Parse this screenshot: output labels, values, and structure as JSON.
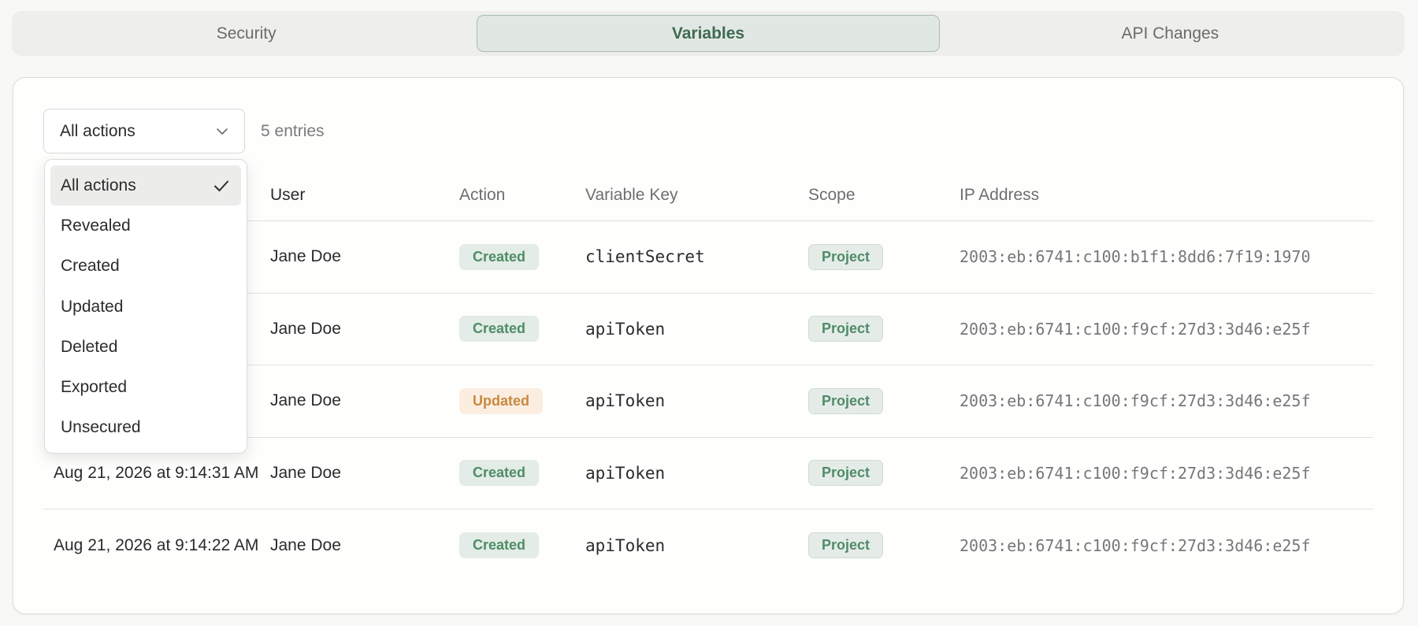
{
  "tabs": [
    {
      "label": "Security",
      "active": false
    },
    {
      "label": "Variables",
      "active": true
    },
    {
      "label": "API Changes",
      "active": false
    }
  ],
  "filter": {
    "selected": "All actions",
    "icon": "chevron-down-icon",
    "options": [
      "All actions",
      "Revealed",
      "Created",
      "Updated",
      "Deleted",
      "Exported",
      "Unsecured"
    ],
    "checked_icon": "check-icon"
  },
  "entries_count": "5 entries",
  "table": {
    "headers": {
      "user": "User",
      "action": "Action",
      "key": "Variable Key",
      "scope": "Scope",
      "ip": "IP Address"
    },
    "rows": [
      {
        "date": "",
        "user": "Jane Doe",
        "action": "Created",
        "action_type": "created",
        "key": "clientSecret",
        "scope": "Project",
        "ip": "2003:eb:6741:c100:b1f1:8dd6:7f19:1970"
      },
      {
        "date": "",
        "user": "Jane Doe",
        "action": "Created",
        "action_type": "created",
        "key": "apiToken",
        "scope": "Project",
        "ip": "2003:eb:6741:c100:f9cf:27d3:3d46:e25f"
      },
      {
        "date": "",
        "user": "Jane Doe",
        "action": "Updated",
        "action_type": "updated",
        "key": "apiToken",
        "scope": "Project",
        "ip": "2003:eb:6741:c100:f9cf:27d3:3d46:e25f"
      },
      {
        "date": "Aug 21, 2026 at 9:14:31 AM",
        "user": "Jane Doe",
        "action": "Created",
        "action_type": "created",
        "key": "apiToken",
        "scope": "Project",
        "ip": "2003:eb:6741:c100:f9cf:27d3:3d46:e25f"
      },
      {
        "date": "Aug 21, 2026 at 9:14:22 AM",
        "user": "Jane Doe",
        "action": "Created",
        "action_type": "created",
        "key": "apiToken",
        "scope": "Project",
        "ip": "2003:eb:6741:c100:f9cf:27d3:3d46:e25f"
      }
    ]
  },
  "colors": {
    "accent": "#3f6b52",
    "created_text": "#4f8c68",
    "updated_text": "#c8893f"
  }
}
